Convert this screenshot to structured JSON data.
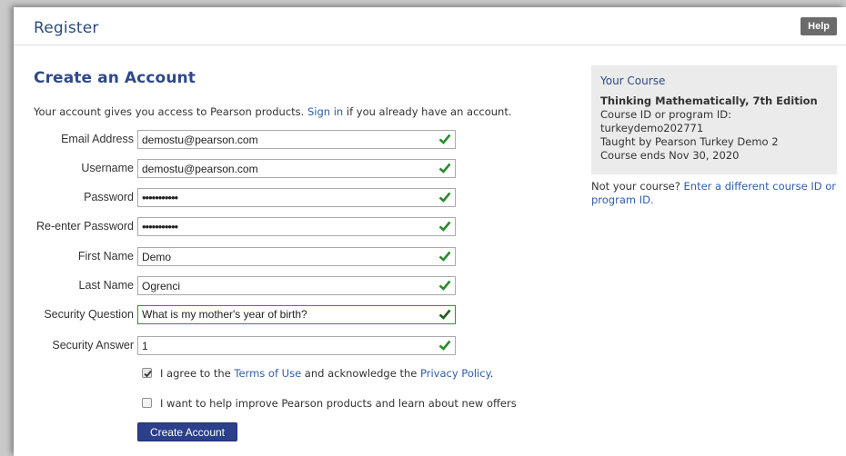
{
  "header": {
    "title": "Register",
    "help_label": "Help"
  },
  "page": {
    "heading": "Create an Account",
    "intro_before": "Your account gives you access to Pearson products. ",
    "intro_link": "Sign in",
    "intro_after": " if you already have an account."
  },
  "form": {
    "fields": [
      {
        "label": "Email Address",
        "value": "demostu@pearson.com"
      },
      {
        "label": "Username",
        "value": "demostu@pearson.com"
      },
      {
        "label": "Password",
        "value": "•••••••••••"
      },
      {
        "label": "Re-enter Password",
        "value": "•••••••••••"
      },
      {
        "label": "First Name",
        "value": "Demo"
      },
      {
        "label": "Last Name",
        "value": "Ogrenci"
      },
      {
        "label": "Security Question",
        "value": "What is my mother's year of birth?"
      },
      {
        "label": "Security Answer",
        "value": "1"
      }
    ],
    "terms_before": "I agree to the ",
    "terms_link": "Terms of Use",
    "terms_middle": " and acknowledge the ",
    "privacy_link": "Privacy Policy",
    "terms_after": ".",
    "terms_checked": true,
    "offers_text": "I want to help improve Pearson products and learn about new offers",
    "offers_checked": false,
    "submit_label": "Create Account"
  },
  "course": {
    "panel_title": "Your Course",
    "name": "Thinking Mathematically, 7th Edition",
    "id_label": "Course ID or program ID:",
    "id_value": "turkeydemo202771",
    "taught_by": "Taught by Pearson Turkey Demo 2",
    "ends": "Course ends Nov 30, 2020",
    "not_yours": "Not your course? ",
    "different_link": "Enter a different course ID or program ID."
  },
  "colors": {
    "accent": "#2f4a8a",
    "link": "#2f5dab",
    "valid": "#2e8b2e",
    "button": "#2b3f8a"
  },
  "icons": {
    "valid": "check-icon",
    "checkbox": "checkbox-check-icon"
  }
}
